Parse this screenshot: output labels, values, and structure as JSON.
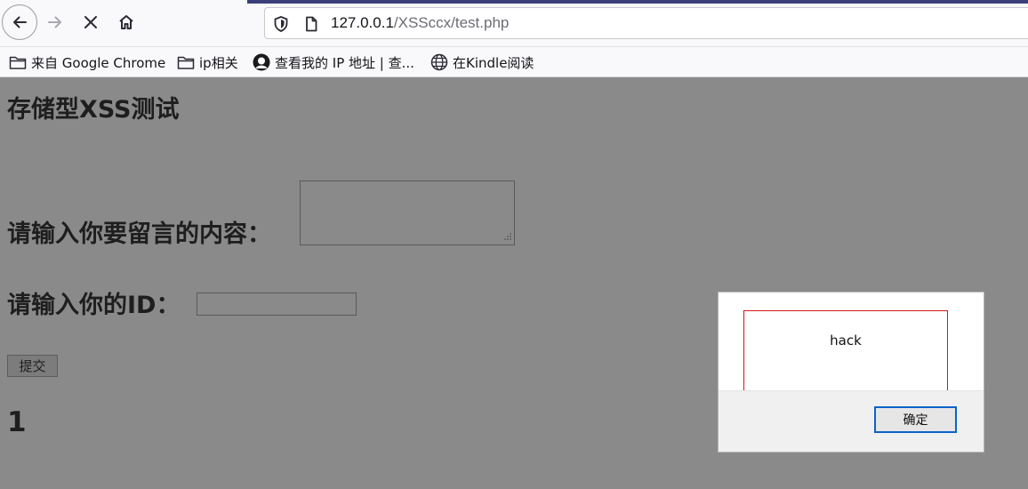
{
  "browser": {
    "url_host": "127.0.0.1",
    "url_path": "/XSSccx/test.php",
    "bookmarks": [
      {
        "label": "来自 Google Chrome",
        "icon": "folder-icon"
      },
      {
        "label": "ip相关",
        "icon": "folder-icon"
      },
      {
        "label": "查看我的 IP 地址 | 查...",
        "icon": "github-avatar-icon"
      },
      {
        "label": "在Kindle阅读",
        "icon": "globe-icon"
      }
    ]
  },
  "page": {
    "title": "存储型XSS测试",
    "message_label": "请输入你要留言的内容：",
    "message_value": "",
    "id_label": "请输入你的ID：",
    "id_value": "",
    "submit_label": "提交",
    "result": "1"
  },
  "dialog": {
    "message": "hack",
    "ok_label": "确定"
  },
  "colors": {
    "overlay_gray": "#8a8a8a",
    "ok_border": "#0a64c8",
    "message_border": "#d01818"
  }
}
